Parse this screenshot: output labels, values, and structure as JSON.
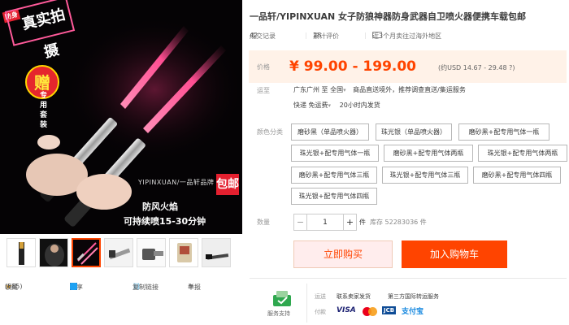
{
  "gallery": {
    "badge": "防身",
    "stamp": "真实拍摄",
    "gift": "赠",
    "gift_desc": "专用套装",
    "watermark": "YIPINXUAN/一品轩品牌",
    "caption_flame": "防风火焰",
    "caption_spray": "可持续喷15-30分钟",
    "free_shipping": "包邮",
    "thumb_count": 7,
    "active_thumb": 3
  },
  "bottom_bar": {
    "star_icon": "star-icon",
    "favorite_label": "收藏",
    "favorite_count": "(885)",
    "share_label": "分享",
    "copy_link_label": "复制链接",
    "report_label": "举报"
  },
  "product": {
    "title": "一品轩/YIPINXUAN 女子防狼神器防身武器自卫喷火器便携车载包邮",
    "stats": {
      "deals_label": "成交记录",
      "deals_value": "42",
      "reviews_label": "累计评价",
      "reviews_value": "28",
      "overseas_text": "近3个月卖往过海外地区"
    },
    "price_label": "价格",
    "price": "¥ 99.00 - 199.00",
    "price_usd": "(约USD 14.67 - 29.48 ?)",
    "shipping_label": "运至",
    "shipping_from": "广东广州 至",
    "shipping_to": "全国",
    "shipping_note": "商品直送境外，推荐调查直送/集运服务",
    "express": "快递 免运费",
    "express_time": "20小时内发货",
    "color_label": "颜色分类",
    "options": [
      "磨砂黑（单品喷火器）",
      "珠光银（单品喷火器）",
      "磨砂黑+配专用气体一瓶",
      "珠光银+配专用气体一瓶",
      "磨砂黑+配专用气体两瓶",
      "珠光银+配专用气体两瓶",
      "磨砂黑+配专用气体三瓶",
      "珠光银+配专用气体三瓶",
      "磨砂黑+配专用气体四瓶",
      "珠光银+配专用气体四瓶"
    ],
    "qty_label": "数量",
    "qty_minus": "−",
    "qty_plus": "+",
    "qty_value": "1",
    "qty_unit": "件",
    "stock": "库存 52283036 件",
    "buy_now": "立即购买",
    "add_to_cart": "加入购物车"
  },
  "service": {
    "label": "服务支持",
    "row1_label": "运送",
    "row1_items": [
      "联系卖家发货",
      "第三方国际转运服务"
    ],
    "row2_label": "付款",
    "payments": [
      "VISA",
      "MasterCard",
      "JCB",
      "支付宝"
    ]
  },
  "colors": {
    "accent": "#ff4400",
    "price_bg": "#fff2e8",
    "buy_bg": "#ffeded"
  }
}
